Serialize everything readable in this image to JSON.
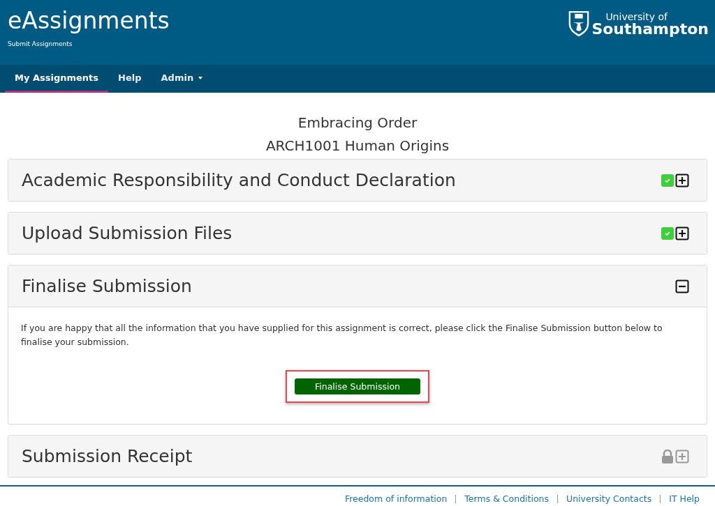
{
  "header": {
    "title": "eAssignments",
    "subtitle": "Submit Assignments",
    "logo": {
      "line_1": "University of",
      "line_2": "Southampton"
    }
  },
  "nav": [
    {
      "label": "My Assignments",
      "selected": true,
      "dropdown": false
    },
    {
      "label": "Help",
      "selected": false,
      "dropdown": false
    },
    {
      "label": "Admin",
      "selected": false,
      "dropdown": true
    }
  ],
  "assignment": {
    "title": "Embracing Order",
    "module": "ARCH1001 Human Origins"
  },
  "sections": [
    {
      "title": "Academic Responsibility and Conduct Declaration",
      "complete": true,
      "locked": false,
      "expanded": false
    },
    {
      "title": "Upload Submission Files",
      "complete": true,
      "locked": false,
      "expanded": false
    },
    {
      "title": "Finalise Submission",
      "complete": false,
      "locked": false,
      "expanded": true,
      "text": "If you are happy that all the information that you have supplied for this assignment is correct, please click the Finalise Submission button below to finalise your submission.",
      "button": {
        "label": "Finalise Submission",
        "highlighted": true
      }
    },
    {
      "title": "Submission Receipt",
      "complete": false,
      "locked": true,
      "expanded": false
    }
  ],
  "footer_links": [
    "Freedom of information",
    "Terms & Conditions",
    "University Contacts",
    "IT Help"
  ]
}
